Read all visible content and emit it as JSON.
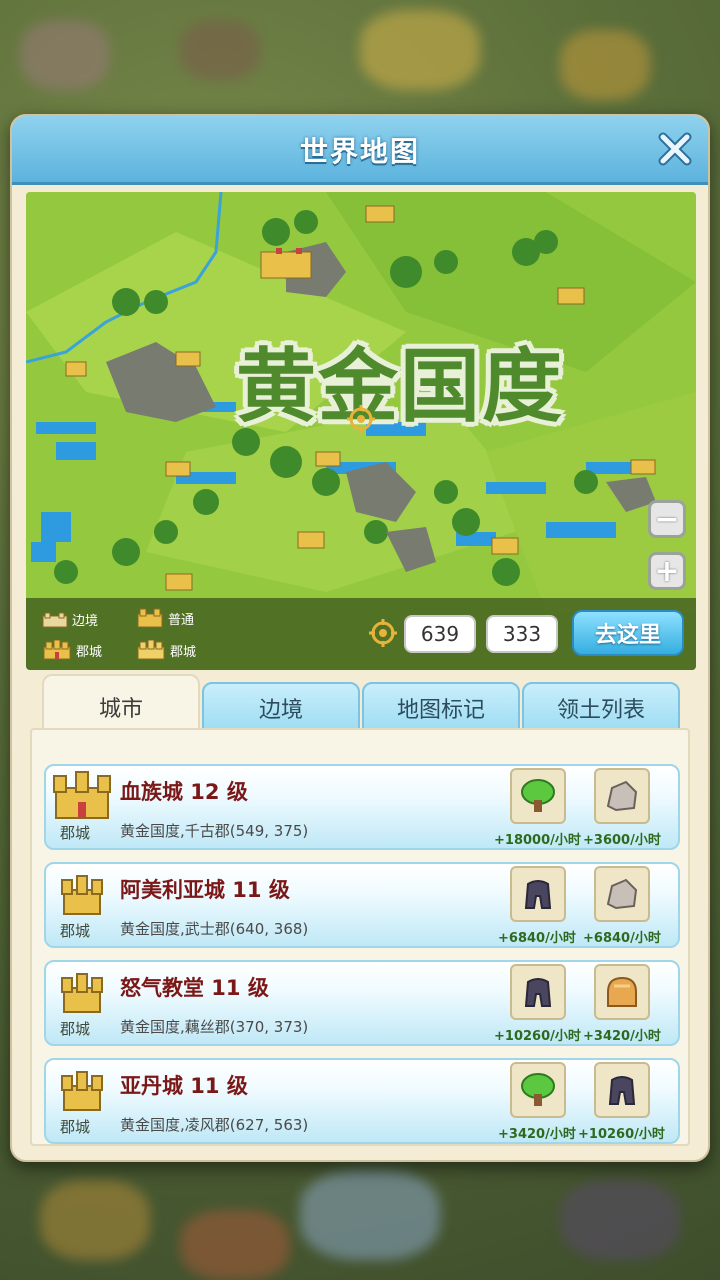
{
  "dialog": {
    "title": "世界地图"
  },
  "map": {
    "region_name": "黄金国度",
    "legend": [
      {
        "label": "边境",
        "icon": "border-city-icon"
      },
      {
        "label": "普通",
        "icon": "normal-city-icon"
      },
      {
        "label": "郡城",
        "icon": "county-city-icon"
      },
      {
        "label": "郡城",
        "icon": "county-city-alt-icon"
      }
    ],
    "coord_x": "639",
    "coord_y": "333",
    "go_label": "去这里",
    "zoom_out": "−",
    "zoom_in": "+"
  },
  "tabs": [
    {
      "label": "城市",
      "active": true
    },
    {
      "label": "边境",
      "active": false
    },
    {
      "label": "地图标记",
      "active": false
    },
    {
      "label": "领土列表",
      "active": false
    }
  ],
  "cities": [
    {
      "name": "血族城 12 级",
      "type": "郡城",
      "location": "黄金国度,千古郡(549, 375)",
      "resources": [
        {
          "icon": "wood-icon",
          "rate": "+18000/小时"
        },
        {
          "icon": "stone-icon",
          "rate": "+3600/小时"
        }
      ]
    },
    {
      "name": "阿美利亚城 11 级",
      "type": "郡城",
      "location": "黄金国度,武士郡(640, 368)",
      "resources": [
        {
          "icon": "iron-icon",
          "rate": "+6840/小时"
        },
        {
          "icon": "stone-icon",
          "rate": "+6840/小时"
        }
      ]
    },
    {
      "name": "怒气教堂 11 级",
      "type": "郡城",
      "location": "黄金国度,藕丝郡(370, 373)",
      "resources": [
        {
          "icon": "iron-icon",
          "rate": "+10260/小时"
        },
        {
          "icon": "bread-icon",
          "rate": "+3420/小时"
        }
      ]
    },
    {
      "name": "亚丹城 11 级",
      "type": "郡城",
      "location": "黄金国度,凌风郡(627, 563)",
      "resources": [
        {
          "icon": "wood-icon",
          "rate": "+3420/小时"
        },
        {
          "icon": "iron-icon",
          "rate": "+10260/小时"
        }
      ]
    }
  ],
  "colors": {
    "title_bar": "#5cb3dd",
    "go_button": "#35aee0",
    "city_name": "#7a1818",
    "rate_text": "#2d6a1f",
    "map_grass": "#8cc63e"
  }
}
